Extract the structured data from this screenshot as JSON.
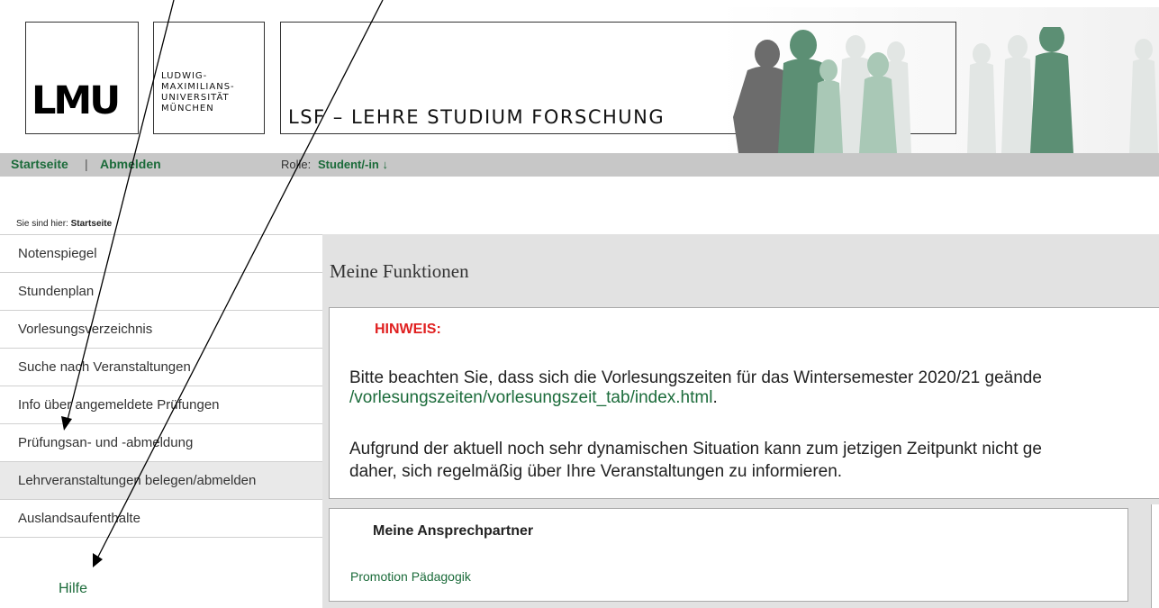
{
  "header": {
    "logo_mark": "LMU",
    "university_name": "LUDWIG-\nMAXIMILIANS-\nUNIVERSITÄT\nMÜNCHEN",
    "site_title": "LSF – LEHRE STUDIUM FORSCHUNG"
  },
  "nav": {
    "start_label": "Startseite",
    "separator": "|",
    "logout_label": "Abmelden",
    "role_label": "Rolle:",
    "role_value": "Student/-in ↓"
  },
  "breadcrumb": {
    "prefix": "Sie sind hier:",
    "current": "Startseite"
  },
  "sidebar": {
    "items": [
      {
        "label": "Notenspiegel"
      },
      {
        "label": "Stundenplan"
      },
      {
        "label": "Vorlesungsverzeichnis"
      },
      {
        "label": "Suche nach Veranstaltungen"
      },
      {
        "label": "Info über angemeldete Prüfungen"
      },
      {
        "label": "Prüfungsan- und -abmeldung"
      },
      {
        "label": "Lehrveranstaltungen belegen/abmelden"
      },
      {
        "label": "Auslandsaufenthalte"
      }
    ],
    "help_label": "Hilfe"
  },
  "main": {
    "title": "Meine Funktionen",
    "hint": {
      "label": "HINWEIS:",
      "line1": "Bitte beachten Sie, dass sich die Vorlesungszeiten für das Wintersemester 2020/21 geände",
      "line2": "/vorlesungszeiten/vorlesungszeit_tab/index.html",
      "line2_end": ".",
      "line3": "Aufgrund der aktuell noch sehr dynamischen Situation kann zum jetzigen Zeitpunkt nicht ge",
      "line4": "daher, sich regelmäßig über Ihre Veranstaltungen zu informieren."
    },
    "contacts": {
      "title": "Meine Ansprechpartner",
      "link": "Promotion Pädagogik"
    }
  },
  "colors": {
    "link_green": "#1b6b3a",
    "hint_red": "#e02020",
    "nav_gray": "#c7c7c7",
    "main_gray": "#e2e2e2"
  }
}
